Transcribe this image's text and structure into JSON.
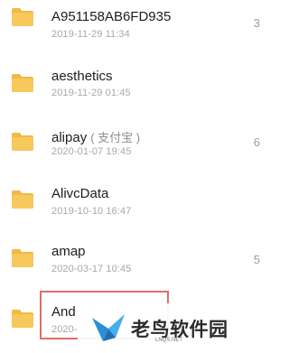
{
  "files": [
    {
      "name": "A951158AB6FD935",
      "date": "2019-11-29 11:34",
      "side": "3"
    },
    {
      "name": "aesthetics",
      "date": "2019-11-29 01:45",
      "side": ""
    },
    {
      "name": "alipay",
      "alias": "( 支付宝 )",
      "date": "2020-01-07 19:45",
      "side": "6"
    },
    {
      "name": "AlivcData",
      "date": "2019-10-10 16:47",
      "side": ""
    },
    {
      "name": "amap",
      "date": "2020-03-17 10:45",
      "side": "5"
    },
    {
      "name": "And",
      "date": "2020-",
      "side": ""
    }
  ],
  "watermark": {
    "text": "老鸟软件园",
    "url": "LNQS.NET"
  },
  "colors": {
    "folder": "#f7c85c",
    "folder_tab": "#f3b942",
    "highlight": "#e36b6b"
  }
}
